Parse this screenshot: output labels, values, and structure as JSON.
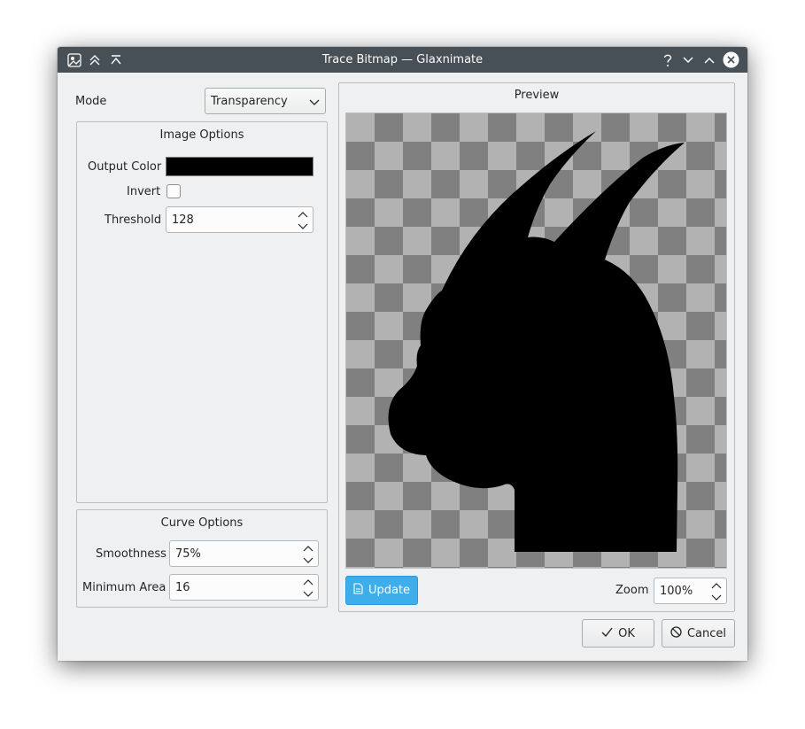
{
  "window": {
    "title": "Trace Bitmap — Glaxnimate",
    "titlebar_icons": [
      "app-icon",
      "keep-above-icon",
      "keep-below-icon",
      "help-icon",
      "minimize-icon",
      "maximize-icon",
      "close-icon"
    ]
  },
  "mode": {
    "label": "Mode",
    "value": "Transparency"
  },
  "image_options": {
    "title": "Image Options",
    "output_color_label": "Output Color",
    "output_color": "#000000",
    "invert_label": "Invert",
    "invert_checked": false,
    "threshold_label": "Threshold",
    "threshold_value": "128"
  },
  "curve_options": {
    "title": "Curve Options",
    "smoothness_label": "Smoothness",
    "smoothness_value": "75%",
    "min_area_label": "Minimum Area",
    "min_area_value": "16"
  },
  "preview": {
    "title": "Preview",
    "update_label": "Update",
    "zoom_label": "Zoom",
    "zoom_value": "100%"
  },
  "buttons": {
    "ok_label": "OK",
    "cancel_label": "Cancel"
  },
  "colors": {
    "titlebar": "#475057",
    "accent": "#3daee9",
    "window_bg": "#eff0f1"
  }
}
